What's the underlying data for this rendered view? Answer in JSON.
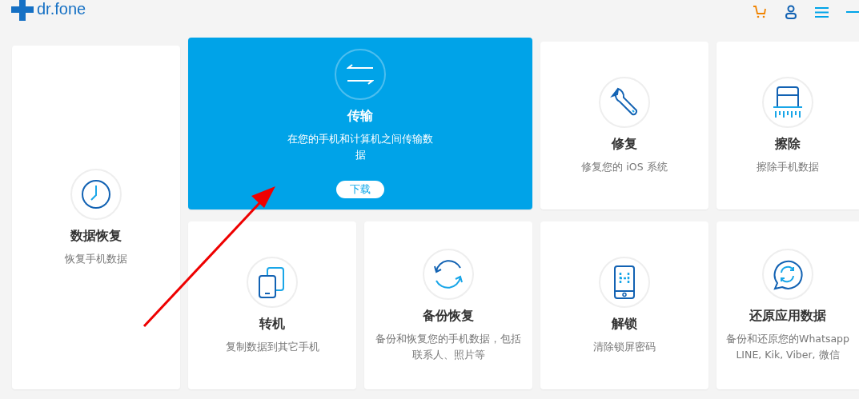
{
  "header": {
    "logo": "dr.fone"
  },
  "cards": [
    {
      "kind": "recover",
      "title": "数据恢复",
      "description": "恢复手机数据",
      "selected": false
    },
    {
      "kind": "transfer",
      "title": "传输",
      "description": "在您的手机和计算机之间传输数据",
      "selected": true,
      "button": "下载"
    },
    {
      "kind": "repair",
      "title": "修复",
      "description": "修复您的 iOS 系统",
      "selected": false
    },
    {
      "kind": "erase",
      "title": "擦除",
      "description": "擦除手机数据",
      "selected": false
    },
    {
      "kind": "switch",
      "title": "转机",
      "description": "复制数据到其它手机",
      "selected": false
    },
    {
      "kind": "backup",
      "title": "备份恢复",
      "description": "备份和恢复您的手机数据，包括联系人、照片等",
      "selected": false
    },
    {
      "kind": "unlock",
      "title": "解锁",
      "description": "清除锁屏密码",
      "selected": false
    },
    {
      "kind": "restore",
      "title": "还原应用数据",
      "description": "备份和还原您的Whatsapp LINE, Kik, Viber, 微信",
      "selected": false
    }
  ]
}
